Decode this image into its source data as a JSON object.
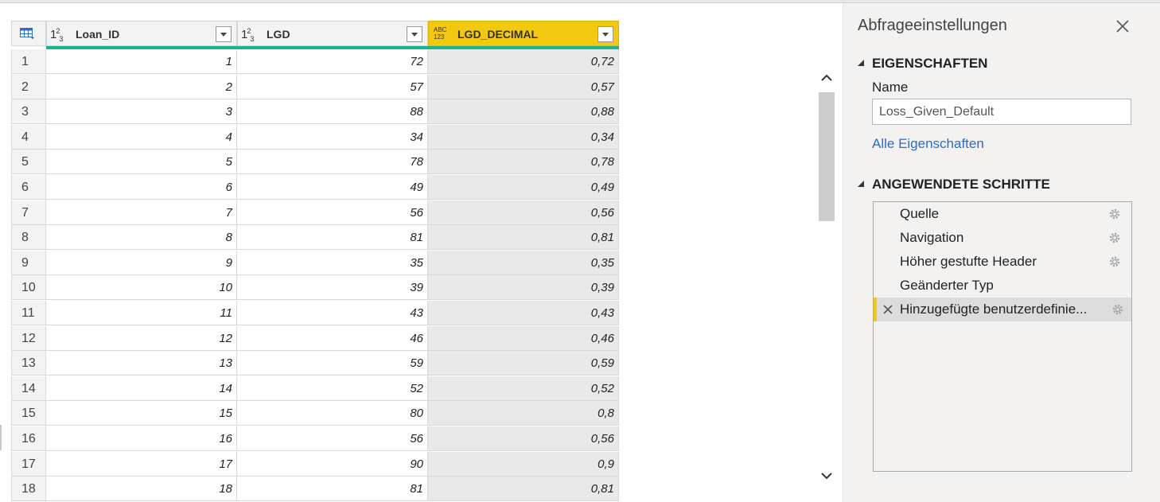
{
  "grid": {
    "columns": [
      {
        "type_icon": "123",
        "name": "Loan_ID"
      },
      {
        "type_icon": "123",
        "name": "LGD"
      },
      {
        "type_icon": "ABC/123",
        "name": "LGD_DECIMAL"
      }
    ],
    "rows": [
      {
        "index": "1",
        "loan_id": "1",
        "lgd": "72",
        "lgd_decimal": "0,72"
      },
      {
        "index": "2",
        "loan_id": "2",
        "lgd": "57",
        "lgd_decimal": "0,57"
      },
      {
        "index": "3",
        "loan_id": "3",
        "lgd": "88",
        "lgd_decimal": "0,88"
      },
      {
        "index": "4",
        "loan_id": "4",
        "lgd": "34",
        "lgd_decimal": "0,34"
      },
      {
        "index": "5",
        "loan_id": "5",
        "lgd": "78",
        "lgd_decimal": "0,78"
      },
      {
        "index": "6",
        "loan_id": "6",
        "lgd": "49",
        "lgd_decimal": "0,49"
      },
      {
        "index": "7",
        "loan_id": "7",
        "lgd": "56",
        "lgd_decimal": "0,56"
      },
      {
        "index": "8",
        "loan_id": "8",
        "lgd": "81",
        "lgd_decimal": "0,81"
      },
      {
        "index": "9",
        "loan_id": "9",
        "lgd": "35",
        "lgd_decimal": "0,35"
      },
      {
        "index": "10",
        "loan_id": "10",
        "lgd": "39",
        "lgd_decimal": "0,39"
      },
      {
        "index": "11",
        "loan_id": "11",
        "lgd": "43",
        "lgd_decimal": "0,43"
      },
      {
        "index": "12",
        "loan_id": "12",
        "lgd": "46",
        "lgd_decimal": "0,46"
      },
      {
        "index": "13",
        "loan_id": "13",
        "lgd": "59",
        "lgd_decimal": "0,59"
      },
      {
        "index": "14",
        "loan_id": "14",
        "lgd": "52",
        "lgd_decimal": "0,52"
      },
      {
        "index": "15",
        "loan_id": "15",
        "lgd": "80",
        "lgd_decimal": "0,8"
      },
      {
        "index": "16",
        "loan_id": "16",
        "lgd": "56",
        "lgd_decimal": "0,56"
      },
      {
        "index": "17",
        "loan_id": "17",
        "lgd": "90",
        "lgd_decimal": "0,9"
      },
      {
        "index": "18",
        "loan_id": "18",
        "lgd": "81",
        "lgd_decimal": "0,81"
      }
    ]
  },
  "panel": {
    "title": "Abfrageeinstellungen",
    "properties_heading": "EIGENSCHAFTEN",
    "name_label": "Name",
    "name_value": "Loss_Given_Default",
    "all_properties_link": "Alle Eigenschaften",
    "steps_heading": "ANGEWENDETE SCHRITTE",
    "steps": [
      {
        "label": "Quelle",
        "has_gear": true,
        "active": false
      },
      {
        "label": "Navigation",
        "has_gear": true,
        "active": false
      },
      {
        "label": "Höher gestufte Header",
        "has_gear": true,
        "active": false
      },
      {
        "label": "Geänderter Typ",
        "has_gear": false,
        "active": false
      },
      {
        "label": "Hinzugefügte benutzerdefinie...",
        "has_gear": true,
        "active": true
      }
    ]
  },
  "colors": {
    "selected_column": "#f2c811",
    "quality_bar": "#1ab394",
    "link": "#2b6cc4"
  }
}
